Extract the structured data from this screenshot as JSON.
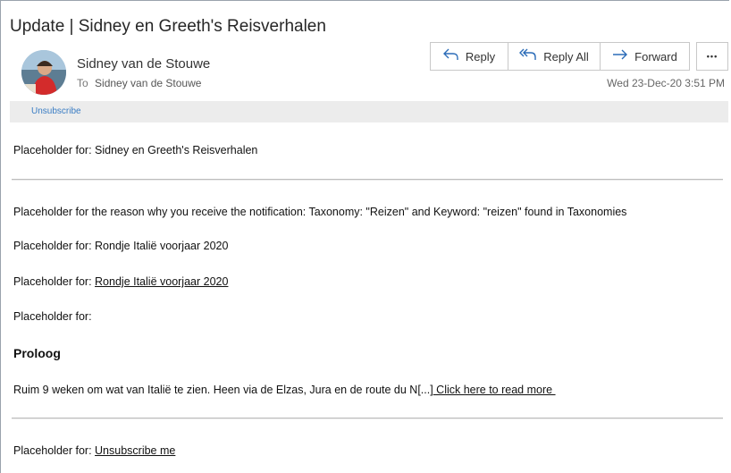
{
  "email": {
    "subject": "Update | Sidney en Greeth's Reisverhalen",
    "sender_name": "Sidney van de Stouwe",
    "to_label": "To",
    "to_name": "Sidney van de Stouwe",
    "date": "Wed 23-Dec-20 3:51 PM",
    "unsubscribe_bar": "Unsubscribe"
  },
  "toolbar": {
    "reply_label": "Reply",
    "reply_all_label": "Reply All",
    "forward_label": "Forward",
    "more_label": "•••",
    "icons": {
      "reply": "reply-icon",
      "reply_all": "reply-all-icon",
      "forward": "forward-icon",
      "more": "more-options-icon"
    },
    "accent_color": "#2b6cb8"
  },
  "body": {
    "line1": "Placeholder for: Sidney en Greeth's Reisverhalen",
    "reason": "Placeholder for the reason why you receive the notification: Taxonomy: \"Reizen\" and Keyword: \"reizen\" found in Taxonomies",
    "line3": "Placeholder for: Rondje Italië voorjaar 2020",
    "line4_prefix": "Placeholder for: ",
    "line4_link": "Rondje Italië voorjaar 2020",
    "line5": "Placeholder for:",
    "heading": "Proloog",
    "excerpt": "Ruim 9 weken om wat van Italië te zien. Heen via de Elzas, Jura en de route du N[...]",
    "read_more_link": " Click here to read more ",
    "footer_prefix": "Placeholder for: ",
    "footer_link": "Unsubscribe me"
  }
}
